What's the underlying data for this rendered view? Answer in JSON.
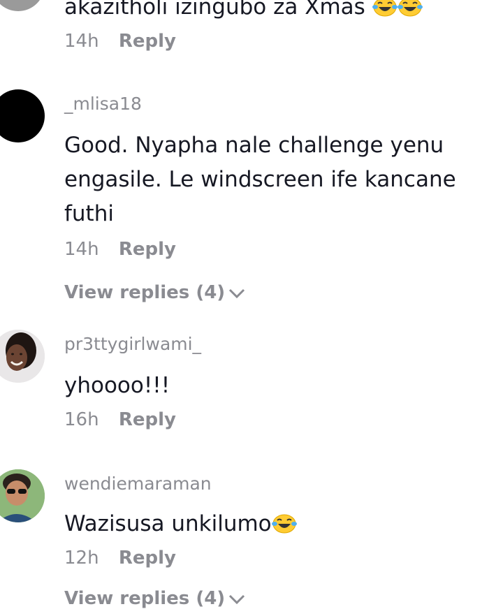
{
  "comments": [
    {
      "username": "",
      "text": "akazitholi izingubo za Xmas",
      "emojis": [
        "face-with-tears-of-joy",
        "face-with-tears-of-joy"
      ],
      "time": "14h",
      "reply_label": "Reply"
    },
    {
      "username": "_mlisa18",
      "text": "Good. Nyapha nale challenge yenu engasile. Le windscreen ife kancane futhi",
      "time": "14h",
      "reply_label": "Reply",
      "view_replies": "View replies (4)"
    },
    {
      "username": "pr3ttygirlwami_",
      "text": "yhoooo!!!",
      "time": "16h",
      "reply_label": "Reply"
    },
    {
      "username": "wendiemaraman",
      "text": "Wazisusa unkilumo",
      "emojis": [
        "face-with-tears-of-joy"
      ],
      "time": "12h",
      "reply_label": "Reply",
      "view_replies": "View replies (4)"
    }
  ],
  "colors": {
    "text": "#161823",
    "secondary": "#8a8b91",
    "emoji_face": "#ffcc33"
  }
}
